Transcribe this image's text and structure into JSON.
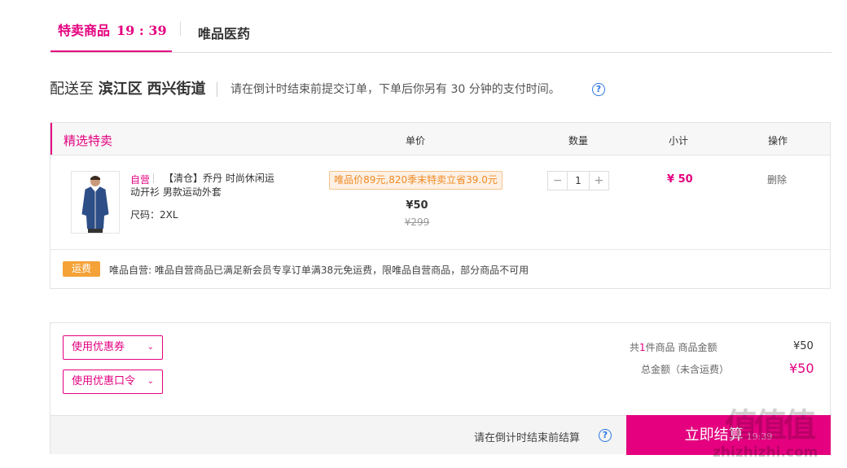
{
  "tabs": {
    "active_label": "特卖商品",
    "countdown": "19 : 39",
    "second_label": "唯品医药"
  },
  "address": {
    "prefix": "配送至",
    "district": "滨江区",
    "street": "西兴街道",
    "tip": "请在倒计时结束前提交订单，下单后你另有 30 分钟的支付时间。",
    "help": "?"
  },
  "cart": {
    "section_title": "精选特卖",
    "columns": [
      "单价",
      "数量",
      "小计",
      "操作"
    ],
    "item": {
      "tag": "自营",
      "name_line1": "【清仓】乔丹 时尚休闲运",
      "name_line2": "动开衫 男款运动外套",
      "size": "尺码：2XL",
      "promo": "唯品价89元,820季末特卖立省39.0元",
      "price": "¥50",
      "original_price": "¥299",
      "qty_minus": "−",
      "qty": "1",
      "qty_plus": "+",
      "subtotal": "¥ 50",
      "delete": "删除"
    },
    "shipping": {
      "badge": "运费",
      "text": "唯品自营: 唯品自营商品已满足新会员专享订单满38元免运费，限唯品自营商品，部分商品不可用"
    }
  },
  "summary": {
    "coupon_label": "使用优惠券",
    "code_label": "使用优惠口令",
    "count_prefix": "共",
    "count": "1",
    "count_suffix": "件商品  商品金额",
    "goods_amount": "¥50",
    "total_label": "总金额（未含运费）",
    "total_amount": "¥50",
    "footer_tip": "请在倒计时结束前结算",
    "checkout_label": "立即结算",
    "checkout_time": "19:39"
  },
  "watermark": {
    "glyphs": "值值值",
    "site": "zhizhizhi.com"
  },
  "colors": {
    "accent": "#e4007f",
    "promo": "#f08a24",
    "badge": "#f5a238",
    "link": "#2b78e4"
  }
}
